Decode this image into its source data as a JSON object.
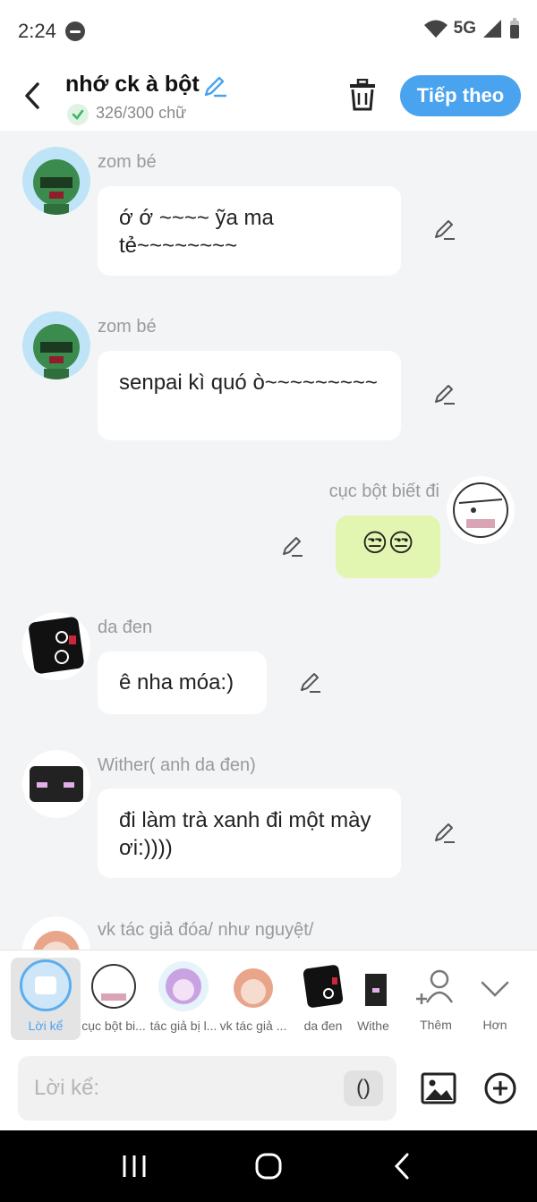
{
  "status_bar": {
    "time": "2:24",
    "network": "5G"
  },
  "header": {
    "title": "nhớ ck à bột",
    "word_count": "326/300 chữ",
    "next_label": "Tiếp theo"
  },
  "messages": [
    {
      "sender": "zom bé",
      "text": "ớ ớ ~~~~ ỹa ma tẻ~~~~~~~~"
    },
    {
      "sender": "zom bé",
      "text": "senpai kì quó ò~~~~~~~~~"
    },
    {
      "sender": "cục bột biết đi",
      "text": "😒😒"
    },
    {
      "sender": "da đen",
      "text": "ê nha móa:)"
    },
    {
      "sender": "Wither( anh da đen)",
      "text": "đi làm trà xanh đi một mày ơi:))))"
    },
    {
      "sender": "vk tác giả đóa/ như nguyệt/"
    }
  ],
  "characters": [
    {
      "label": "Lời kể"
    },
    {
      "label": "cục bột bi..."
    },
    {
      "label": "tác giả bị l..."
    },
    {
      "label": "vk tác giả ..."
    },
    {
      "label": "da đen"
    },
    {
      "label": "Withe"
    },
    {
      "label": "Thêm"
    },
    {
      "label": "Hơn"
    }
  ],
  "composer": {
    "placeholder": "Lời kể:",
    "paren_label": "()"
  },
  "colors": {
    "accent": "#4aa3ee",
    "own_bubble": "#e2f5b1",
    "background": "#f3f4f6"
  }
}
